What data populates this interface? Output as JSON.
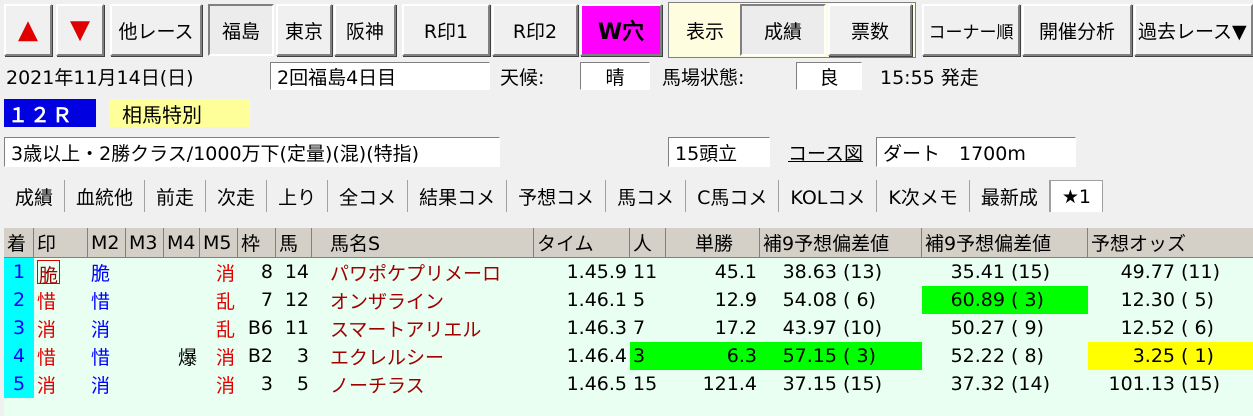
{
  "toolbar": {
    "up_arrow": "▲",
    "down_arrow": "▼",
    "buttons": [
      "他レース",
      "福島",
      "東京",
      "阪神",
      "R印1",
      "R印2",
      "W穴",
      "表示",
      "成績",
      "票数",
      "コーナー順",
      "開催分析",
      "過去レース▼"
    ]
  },
  "race": {
    "date": "2021年11月14日(日)",
    "kaisai": "2回福島4日目",
    "weather_label": "天候:",
    "weather": "晴",
    "track_label": "馬場状態:",
    "track": "良",
    "post_time": "15:55 発走",
    "race_no": "１２Ｒ",
    "race_name": "相馬特別",
    "conditions": "3歳以上・2勝クラス/1000万下(定量)(混)(特指)",
    "runners": "15頭立",
    "course_link": "コース図",
    "course": "ダート　1700m"
  },
  "tabs": [
    "成績",
    "血統他",
    "前走",
    "次走",
    "上り",
    "全コメ",
    "結果コメ",
    "予想コメ",
    "馬コメ",
    "C馬コメ",
    "KOLコメ",
    "K次メモ",
    "最新成",
    "★1"
  ],
  "table": {
    "headers": [
      "着",
      "印",
      "M2",
      "M3",
      "M4",
      "M5",
      "枠",
      "馬",
      "馬名S",
      "タイム",
      "人",
      "単勝",
      "補9予想偏差値",
      "補9予想偏差値",
      "予想オッズ"
    ],
    "rows": [
      {
        "chaku": "1",
        "shirushi": "脆",
        "m2": "脆",
        "m3": "",
        "m4": "",
        "m5": "消",
        "waku": "8",
        "uma": "14",
        "name": "パワポケプリメーロ",
        "time": "1.45.9",
        "ninki": "11",
        "tansho": "45.1",
        "h1": "38.63",
        "h1r": "(13)",
        "h2": "35.41",
        "h2r": "(15)",
        "odds": "49.77",
        "oddsr": "(11)"
      },
      {
        "chaku": "2",
        "shirushi": "惜",
        "m2": "惜",
        "m3": "",
        "m4": "",
        "m5": "乱",
        "waku": "7",
        "uma": "12",
        "name": "オンザライン",
        "time": "1.46.1",
        "ninki": "5",
        "tansho": "12.9",
        "h1": "54.08",
        "h1r": "( 6)",
        "h2": "60.89",
        "h2r": "( 3)",
        "odds": "12.30",
        "oddsr": "( 5)"
      },
      {
        "chaku": "3",
        "shirushi": "消",
        "m2": "消",
        "m3": "",
        "m4": "",
        "m5": "乱",
        "waku": "B6",
        "uma": "11",
        "name": "スマートアリエル",
        "time": "1.46.3",
        "ninki": "7",
        "tansho": "17.2",
        "h1": "43.97",
        "h1r": "(10)",
        "h2": "50.27",
        "h2r": "( 9)",
        "odds": "12.52",
        "oddsr": "( 6)"
      },
      {
        "chaku": "4",
        "shirushi": "惜",
        "m2": "惜",
        "m3": "",
        "m4": "爆",
        "m5": "消",
        "waku": "B2",
        "uma": "3",
        "name": "エクレルシー",
        "time": "1.46.4",
        "ninki": "3",
        "tansho": "6.3",
        "h1": "57.15",
        "h1r": "( 3)",
        "h2": "52.22",
        "h2r": "( 8)",
        "odds": "3.25",
        "oddsr": "( 1)"
      },
      {
        "chaku": "5",
        "shirushi": "消",
        "m2": "消",
        "m3": "",
        "m4": "",
        "m5": "消",
        "waku": "3",
        "uma": "5",
        "name": "ノーチラス",
        "time": "1.46.5",
        "ninki": "15",
        "tansho": "121.4",
        "h1": "37.15",
        "h1r": "(15)",
        "h2": "37.32",
        "h2r": "(14)",
        "odds": "101.13",
        "oddsr": "(15)"
      }
    ]
  },
  "colors": {
    "highlight_green": "#00ff00",
    "highlight_yellow": "#ffff00",
    "rank_cell": "#00ffff",
    "w_ana": "#ff00ff"
  }
}
